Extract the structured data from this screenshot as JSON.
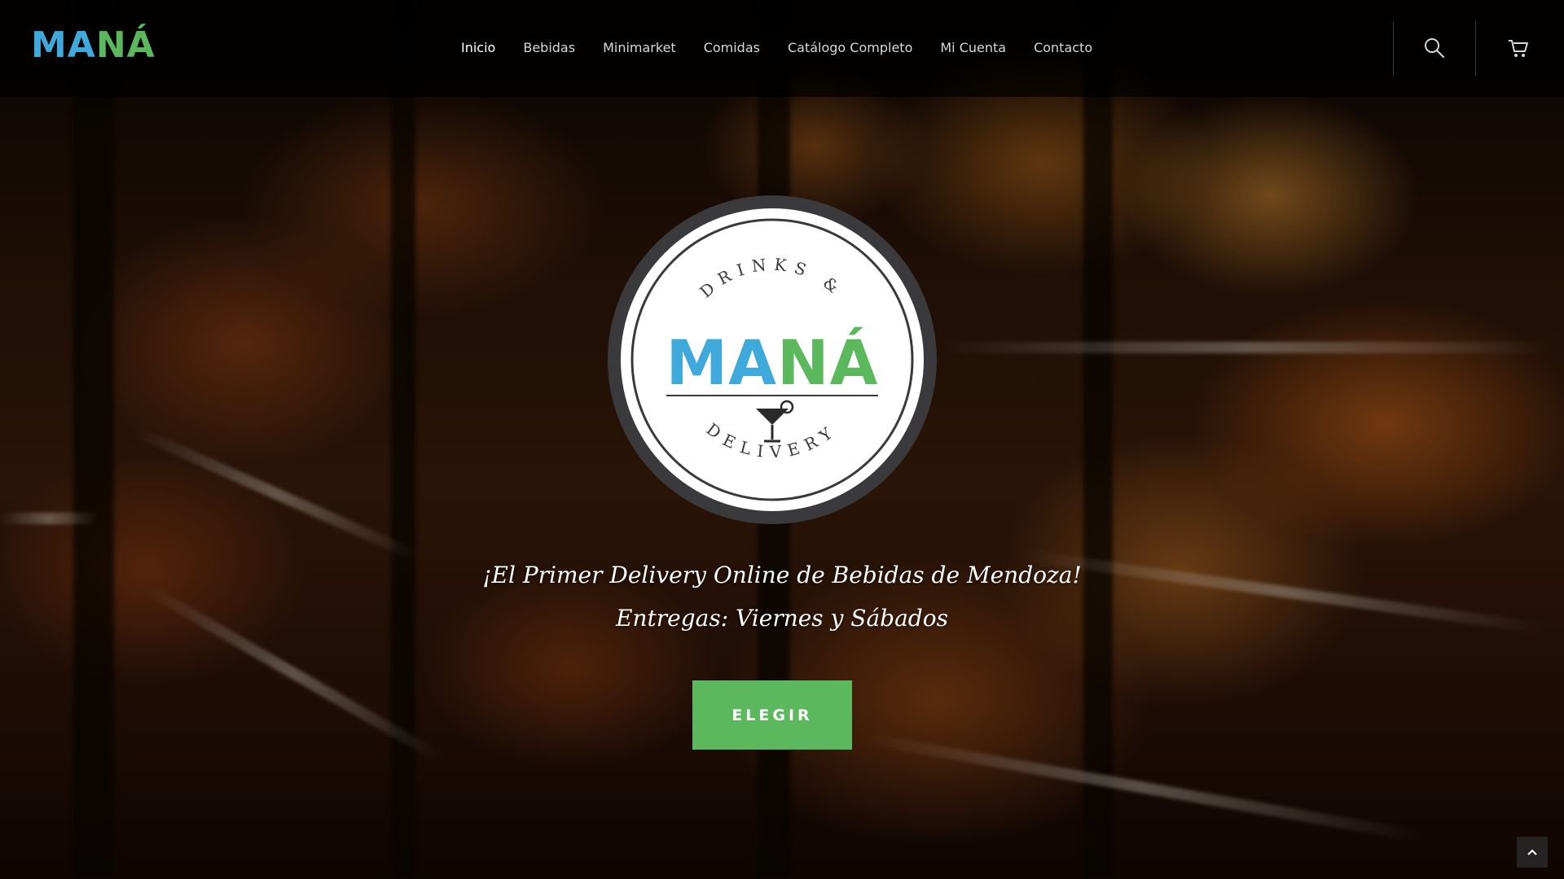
{
  "brand": {
    "logo_ma": "MA",
    "logo_na": "NÁ",
    "colors": {
      "blue": "#3fa9dc",
      "green": "#5cb85c",
      "badge_ring": "#3a3a3c"
    }
  },
  "nav": {
    "items": [
      {
        "label": "Inicio",
        "active": true
      },
      {
        "label": "Bebidas"
      },
      {
        "label": "Minimarket"
      },
      {
        "label": "Comidas"
      },
      {
        "label": "Catálogo Completo"
      },
      {
        "label": "Mi Cuenta"
      },
      {
        "label": "Contacto"
      }
    ],
    "icons": [
      "search-icon",
      "cart-icon"
    ]
  },
  "badge": {
    "top_text": "DRINKS &",
    "brand_ma": "MA",
    "brand_na": "NÁ",
    "bottom_text": "DELIVERY",
    "icon": "cocktail-icon"
  },
  "hero": {
    "tagline_1": "¡El Primer Delivery Online de Bebidas de Mendoza!",
    "tagline_2": "Entregas: Viernes y Sábados",
    "cta_label": "ELEGIR"
  },
  "footer": {
    "to_top_icon": "chevron-up-icon"
  }
}
